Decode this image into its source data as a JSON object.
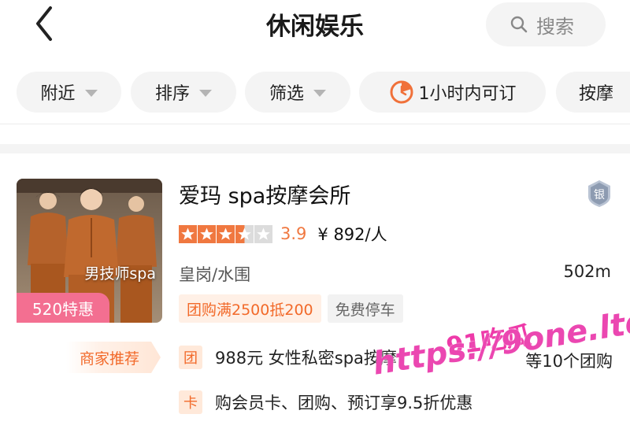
{
  "header": {
    "title": "休闲娱乐",
    "search_label": "搜索"
  },
  "filters": [
    {
      "label": "附近",
      "has_caret": true
    },
    {
      "label": "排序",
      "has_caret": true
    },
    {
      "label": "筛选",
      "has_caret": true
    },
    {
      "label": "1小时内可订",
      "icon": "clock-icon"
    },
    {
      "label": "按摩"
    }
  ],
  "shop": {
    "name": "爱玛 spa按摩会所",
    "image_caption": "男技师spa",
    "promo_badge": "520特惠",
    "level_badge": "银",
    "rating": 3.9,
    "rating_text": "3.9",
    "stars_filled": 3.5,
    "stars_total": 5,
    "price": "¥ 892/人",
    "location": "皇岗/水围",
    "distance": "502m",
    "tags": [
      "团购满2500抵200",
      "免费停车"
    ],
    "recommend_label": "商家推荐",
    "deals": [
      {
        "icon_label": "团",
        "text": "988元 女性私密spa按摩"
      },
      {
        "icon_label": "卡",
        "text": "购会员卡、团购、预订享9.5折优惠"
      }
    ],
    "deal_count": "等10个团购"
  },
  "watermark": {
    "top": "91吃瓜",
    "url": "https://9one.ltd"
  },
  "colors": {
    "accent": "#f26a2a",
    "star": "#f07840",
    "promo": "#f36f91",
    "watermark": "#e937aa"
  }
}
